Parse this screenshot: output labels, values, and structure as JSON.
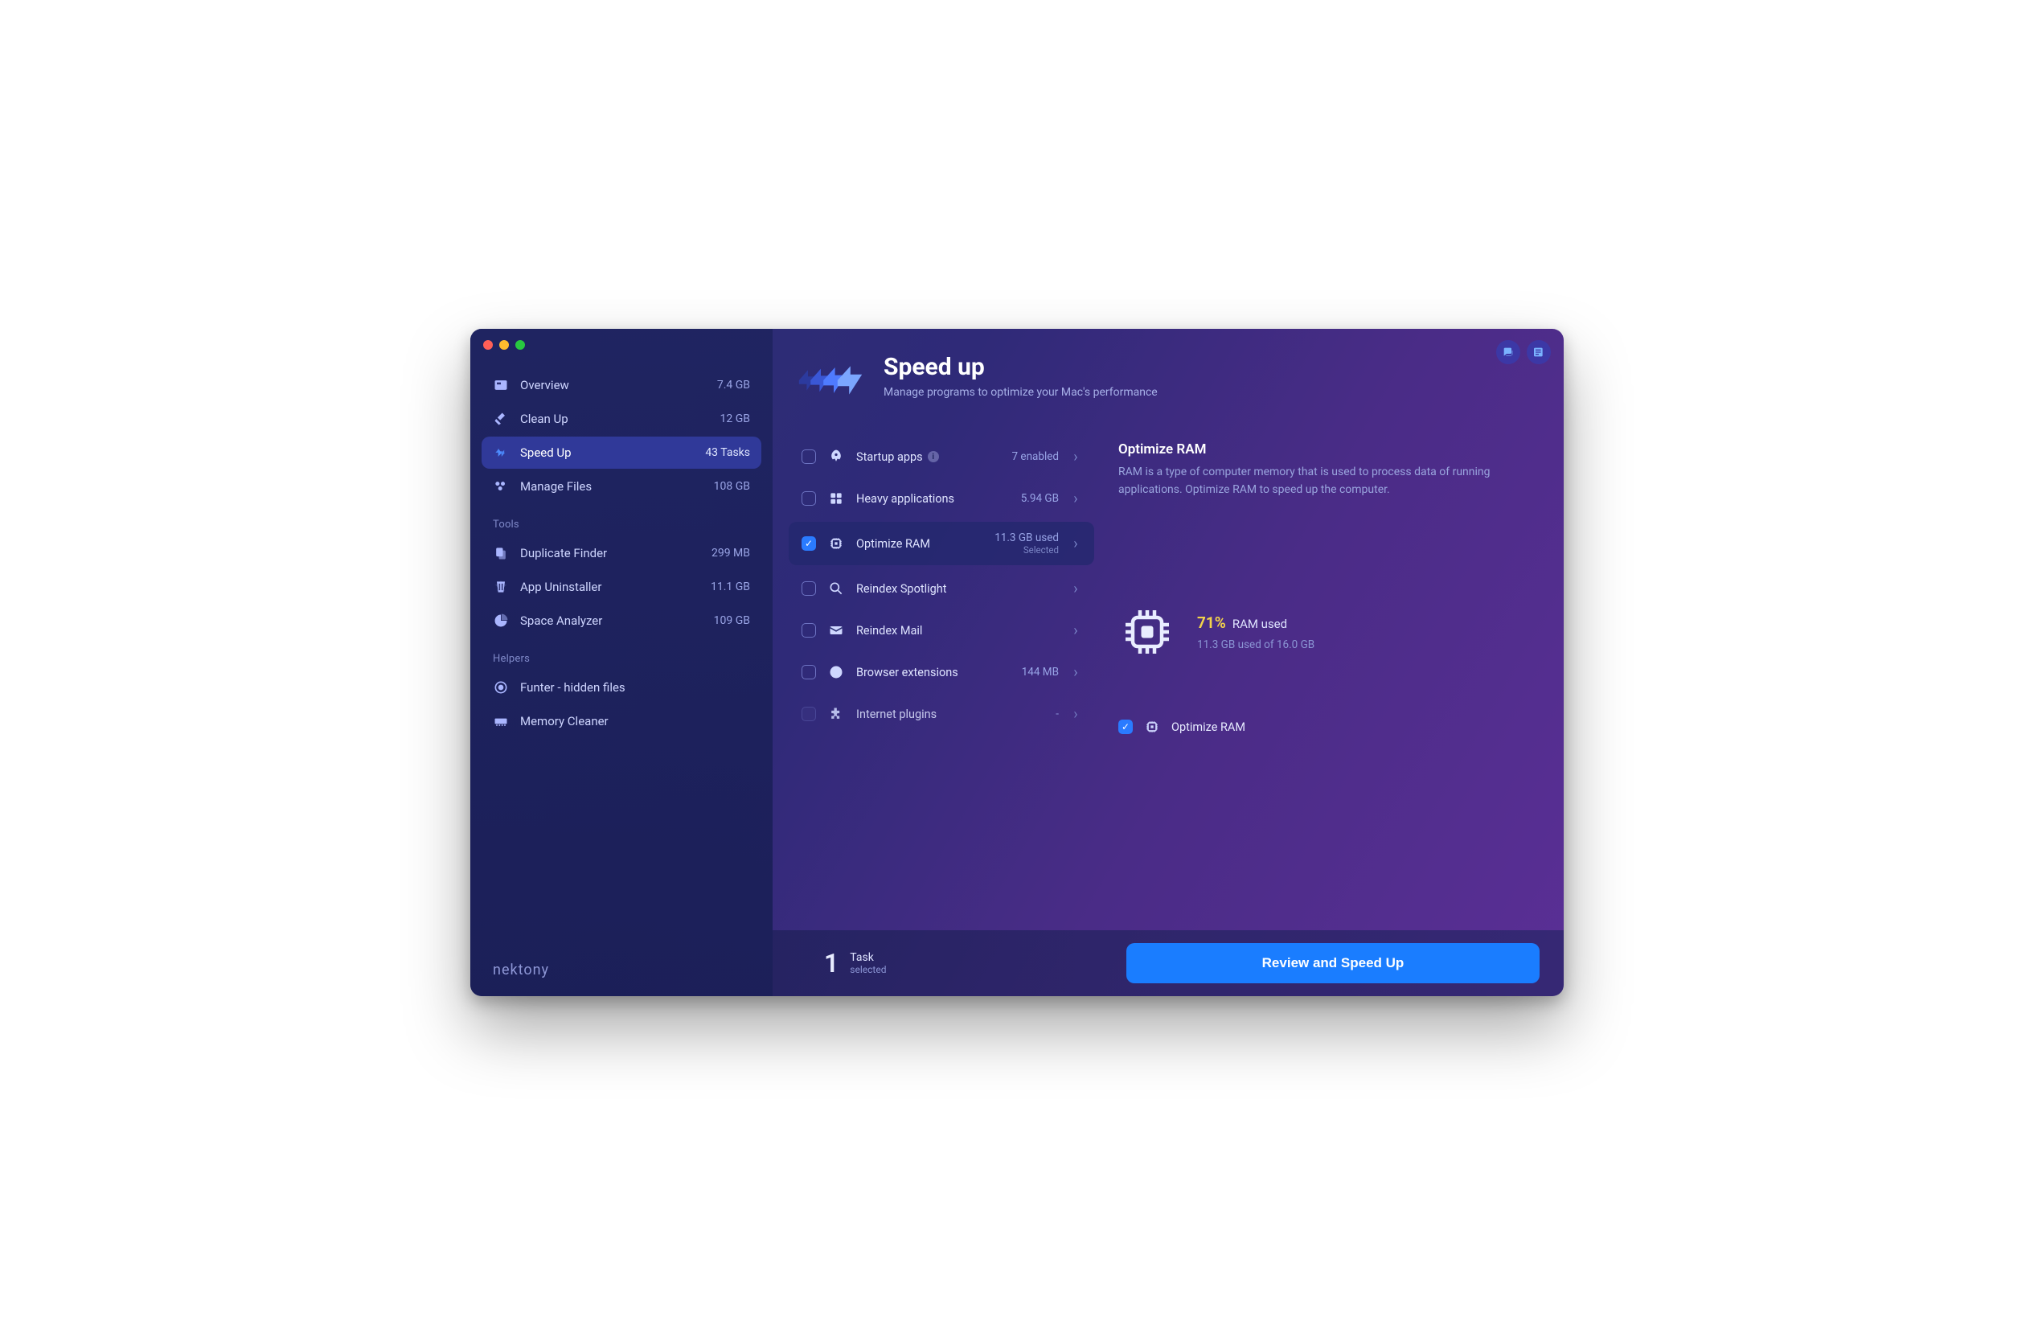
{
  "sidebar": {
    "main": [
      {
        "label": "Overview",
        "badge": "7.4 GB"
      },
      {
        "label": "Clean Up",
        "badge": "12 GB"
      },
      {
        "label": "Speed Up",
        "badge": "43 Tasks"
      },
      {
        "label": "Manage Files",
        "badge": "108 GB"
      }
    ],
    "tools_header": "Tools",
    "tools": [
      {
        "label": "Duplicate Finder",
        "badge": "299 MB"
      },
      {
        "label": "App Uninstaller",
        "badge": "11.1 GB"
      },
      {
        "label": "Space Analyzer",
        "badge": "109 GB"
      }
    ],
    "helpers_header": "Helpers",
    "helpers": [
      {
        "label": "Funter - hidden files"
      },
      {
        "label": "Memory Cleaner"
      }
    ]
  },
  "brand": "nektony",
  "header": {
    "title": "Speed up",
    "subtitle": "Manage programs to optimize your Mac's performance"
  },
  "tasks": [
    {
      "label": "Startup apps",
      "info": true,
      "value": "7 enabled"
    },
    {
      "label": "Heavy applications",
      "value": "5.94 GB"
    },
    {
      "label": "Optimize RAM",
      "value": "11.3 GB used",
      "sub": "Selected",
      "checked": true
    },
    {
      "label": "Reindex Spotlight",
      "value": ""
    },
    {
      "label": "Reindex Mail",
      "value": ""
    },
    {
      "label": "Browser extensions",
      "value": "144 MB"
    },
    {
      "label": "Internet plugins",
      "value": "-",
      "disabled": true
    }
  ],
  "detail": {
    "title": "Optimize RAM",
    "description": "RAM is a type of computer memory that is used to process data of running applications. Optimize RAM to speed up the computer.",
    "percent": "71%",
    "percent_label": "RAM used",
    "usage": "11.3 GB used of 16.0 GB",
    "selected_label": "Optimize RAM"
  },
  "footer": {
    "count": "1",
    "count_label": "Task",
    "count_sub": "selected",
    "cta": "Review and Speed Up"
  }
}
